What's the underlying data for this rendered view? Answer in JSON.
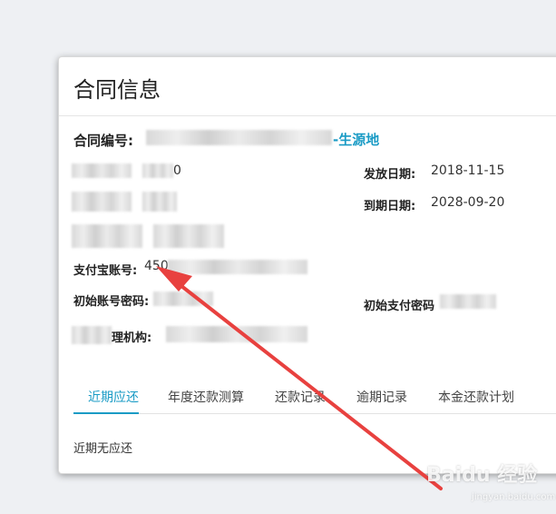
{
  "card": {
    "title": "合同信息"
  },
  "contract": {
    "number_label": "合同编号:",
    "number_suffix": "-生源地",
    "loan_amount_tail": "0",
    "issue_date_label": "发放日期:",
    "issue_date": "2018-11-15",
    "due_date_label": "到期日期:",
    "due_date": "2028-09-20",
    "alipay_label": "支付宝账号:",
    "alipay_prefix": "450",
    "init_account_pwd_label": "初始账号密码:",
    "init_pay_pwd_label": "初始支付密码",
    "agency_label_tail": "理机构:"
  },
  "tabs": [
    {
      "label": "近期应还",
      "active": true
    },
    {
      "label": "年度还款测算",
      "active": false
    },
    {
      "label": "还款记录",
      "active": false
    },
    {
      "label": "逾期记录",
      "active": false
    },
    {
      "label": "本金还款计划",
      "active": false
    }
  ],
  "empty_message": "近期无应还",
  "watermark": {
    "brand": "Baidu 经验",
    "url": "jingyan.baidu.com"
  },
  "colors": {
    "accent": "#1a9bc5",
    "annotation_arrow": "#e8413f"
  }
}
